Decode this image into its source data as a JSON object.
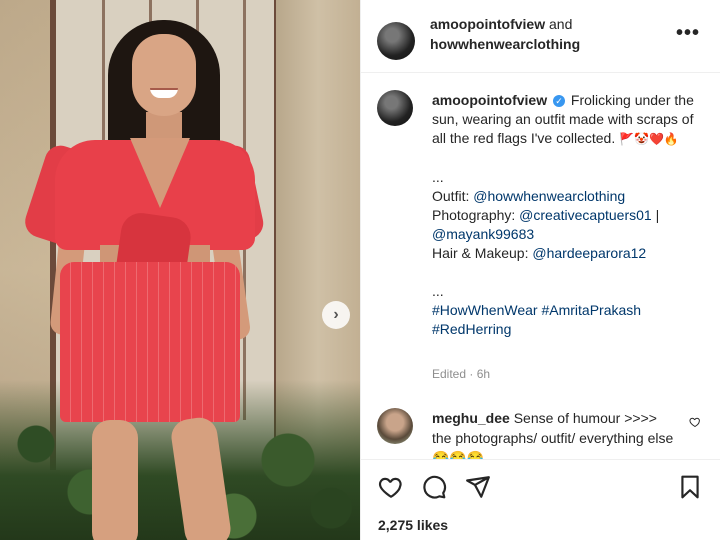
{
  "header": {
    "user1": "amoopointofview",
    "conj": " and",
    "user2": "howwhenwearclothing",
    "more_label": "•••"
  },
  "caption": {
    "username": "amoopointofview",
    "line1": "Frolicking under the sun, wearing an outfit made with scraps of all the red flags I've collected.",
    "emojis": "🚩🤡❤️🔥",
    "dots1": "...",
    "outfit_label": "Outfit: ",
    "outfit_link": "@howwhenwearclothing",
    "photo_label": "Photography: ",
    "photo_link1": "@creativecaptuers01",
    "photo_sep": " |",
    "photo_link2": "@mayank99683",
    "hair_label": "Hair & Makeup: ",
    "hair_link": "@hardeeparora12",
    "dots2": "...",
    "tag1": "#HowWhenWear",
    "tag2": "#AmritaPrakash",
    "tag3": "#RedHerring",
    "edited": "Edited · 6h"
  },
  "comment": {
    "username": "meghu_dee",
    "text": "Sense of humour >>>> the photographs/ outfit/ everything",
    "tail": "else 😂😂😂"
  },
  "likes": "2,275 likes",
  "icons": [
    "heart-icon",
    "comment-icon",
    "share-icon",
    "bookmark-icon",
    "chevron-right-icon",
    "more-icon",
    "verified-icon"
  ]
}
